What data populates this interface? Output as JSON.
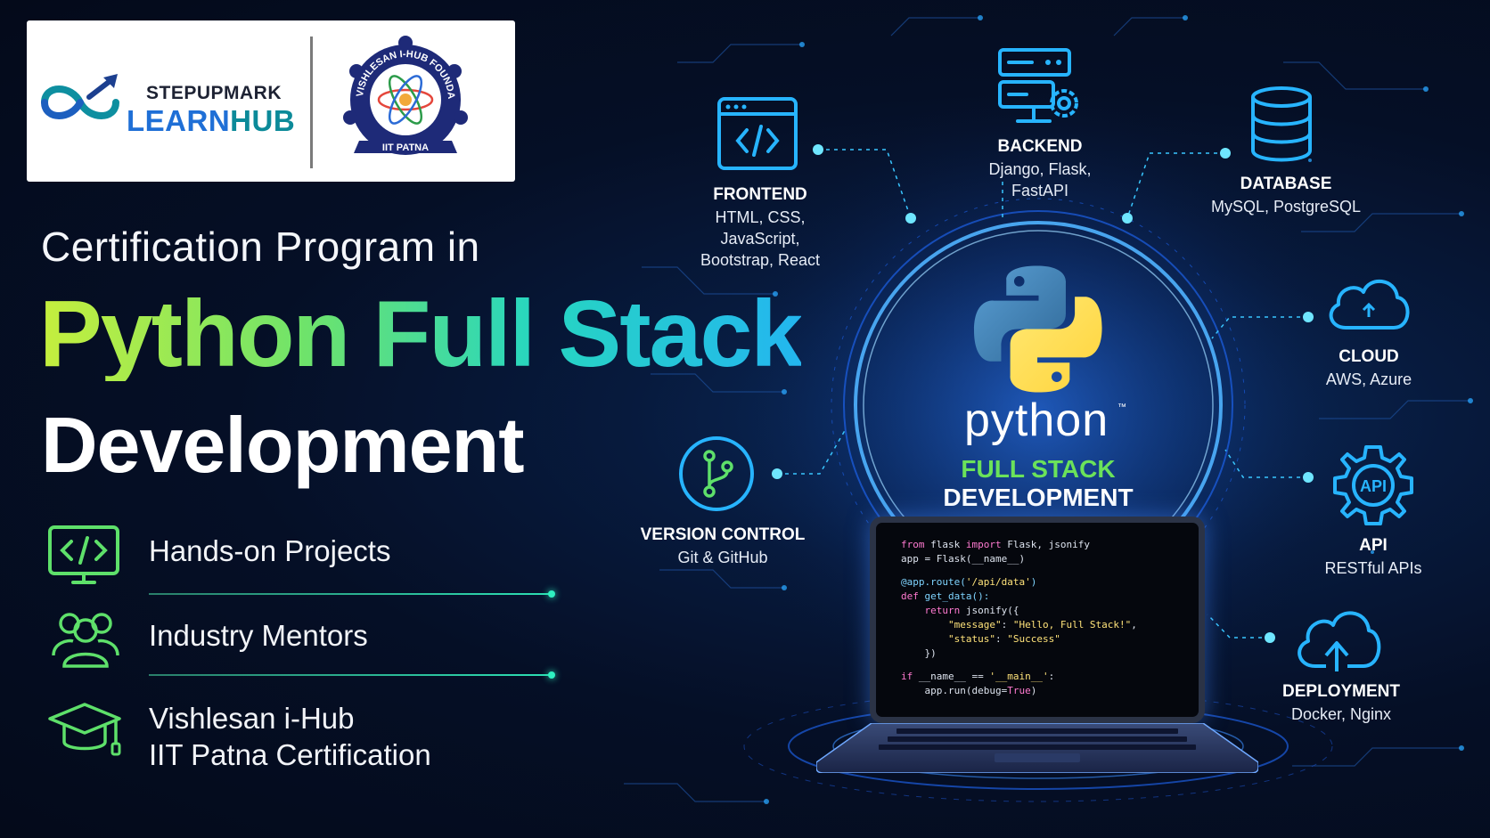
{
  "logo": {
    "brand_top": "STEPUPMARK",
    "brand_learn": "LEARN",
    "brand_hub": "HUB",
    "seal_top": "VISHLESAN I-HUB FOUNDATION",
    "seal_ribbon": "IIT PATNA"
  },
  "headline": {
    "pre": "Certification Program in",
    "main": "Python Full Stack",
    "sub": "Development"
  },
  "features": [
    {
      "icon": "code-monitor-icon",
      "label": "Hands-on Projects"
    },
    {
      "icon": "mentors-icon",
      "label": "Industry Mentors"
    },
    {
      "icon": "graduation-cap-icon",
      "label_line1": "Vishlesan i-Hub",
      "label_line2": "IIT Patna Certification"
    }
  ],
  "nodes": {
    "frontend": {
      "title": "FRONTEND",
      "line1": "HTML, CSS,",
      "line2": "JavaScript,",
      "line3": "Bootstrap, React"
    },
    "backend": {
      "title": "BACKEND",
      "line1": "Django, Flask,",
      "line2": "FastAPI"
    },
    "database": {
      "title": "DATABASE",
      "line1": "MySQL, PostgreSQL"
    },
    "cloud": {
      "title": "CLOUD",
      "line1": "AWS, Azure"
    },
    "api": {
      "title": "API",
      "line1": "RESTful APIs",
      "icon_text": "API"
    },
    "deployment": {
      "title": "DEPLOYMENT",
      "line1": "Docker, Nginx"
    },
    "version_control": {
      "title": "VERSION CONTROL",
      "line1": "Git & GitHub"
    }
  },
  "center": {
    "python_word": "python",
    "tm": "™",
    "line1": "FULL STACK",
    "line2": "DEVELOPMENT"
  },
  "code": {
    "l1_kw1": "from",
    "l1_mid": " flask ",
    "l1_kw2": "import",
    "l1_rest": " Flask, jsonify",
    "l2": "app = Flask(__name__)",
    "l3_a": "@app.route(",
    "l3_str": "'/api/data'",
    "l3_b": ")",
    "l4_kw": "def",
    "l4_rest": " get_data():",
    "l5_kw": "    return",
    "l5_rest": " jsonify({",
    "l6_key": "        \"message\"",
    "l6_colon": ": ",
    "l6_val": "\"Hello, Full Stack!\"",
    "l6_end": ",",
    "l7_key": "        \"status\"",
    "l7_colon": ": ",
    "l7_val": "\"Success\"",
    "l8": "    })",
    "l9_kw": "if",
    "l9_a": " __name__ == ",
    "l9_str": "'__main__'",
    "l9_b": ":",
    "l10_a": "    app.run(debug=",
    "l10_val": "True",
    "l10_b": ")"
  },
  "colors": {
    "background": "#040b1c",
    "accent_green": "#6be25a",
    "accent_cyan": "#2ce0f0",
    "icon_blue": "#27b4ff",
    "python_blue": "#3b77b5",
    "python_yellow": "#ffd43b"
  }
}
